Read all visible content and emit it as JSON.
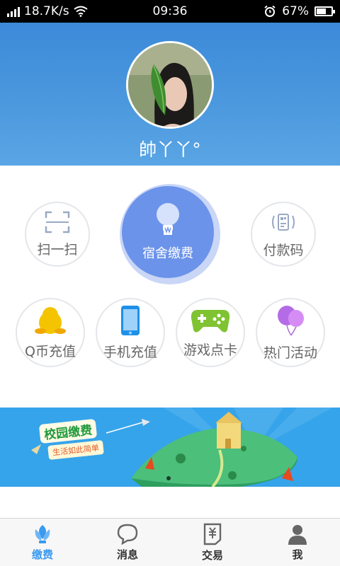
{
  "status_bar": {
    "speed": "18.7K/s",
    "time": "09:36",
    "battery_text": "67%",
    "battery_level": 0.67
  },
  "profile": {
    "username": "帥丫丫°"
  },
  "services": {
    "scan": "扫一扫",
    "dorm_payment": "宿舍缴费",
    "payment_code": "付款码",
    "q_coin": "Q币充值",
    "phone_recharge": "手机充值",
    "game_card": "游戏点卡",
    "hot_events": "热门活动"
  },
  "banner": {
    "title": "校园缴费",
    "subtitle": "生活如此简单"
  },
  "tabs": [
    {
      "label": "缴费",
      "icon": "payment-leaf-icon",
      "active": true
    },
    {
      "label": "消息",
      "icon": "message-bubble-icon",
      "active": false
    },
    {
      "label": "交易",
      "icon": "transaction-doc-icon",
      "active": false
    },
    {
      "label": "我",
      "icon": "person-icon",
      "active": false
    }
  ],
  "colors": {
    "header_blue": "#4b98de",
    "dorm_button": "#6c93ea",
    "active_tab": "#3a9af0",
    "banner_blue": "#36a4ea"
  }
}
